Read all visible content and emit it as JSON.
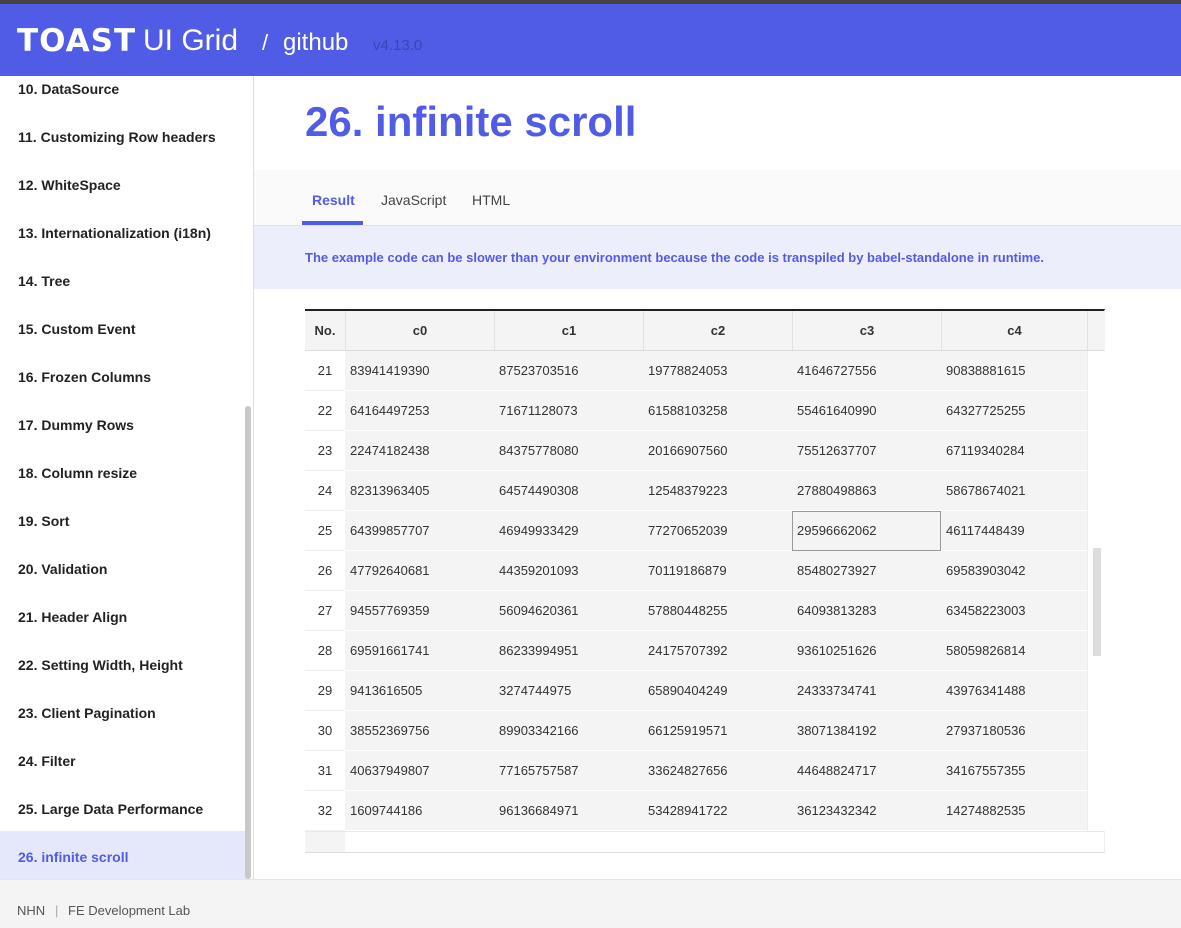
{
  "header": {
    "logo_toast": "TOAST",
    "logo_product": "UI Grid",
    "separator": "/",
    "github_link": "github",
    "version": "v4.13.0"
  },
  "sidebar": {
    "items": [
      {
        "label": "10. DataSource"
      },
      {
        "label": "11. Customizing Row headers"
      },
      {
        "label": "12. WhiteSpace"
      },
      {
        "label": "13. Internationalization (i18n)"
      },
      {
        "label": "14. Tree"
      },
      {
        "label": "15. Custom Event"
      },
      {
        "label": "16. Frozen Columns"
      },
      {
        "label": "17. Dummy Rows"
      },
      {
        "label": "18. Column resize"
      },
      {
        "label": "19. Sort"
      },
      {
        "label": "20. Validation"
      },
      {
        "label": "21. Header Align"
      },
      {
        "label": "22. Setting Width, Height"
      },
      {
        "label": "23. Client Pagination"
      },
      {
        "label": "24. Filter"
      },
      {
        "label": "25. Large Data Performance"
      },
      {
        "label": "26. infinite scroll"
      }
    ],
    "active_index": 16
  },
  "main": {
    "title": "26. infinite scroll",
    "tabs": [
      {
        "label": "Result"
      },
      {
        "label": "JavaScript"
      },
      {
        "label": "HTML"
      }
    ],
    "active_tab": "Result",
    "notice": "The example code can be slower than your environment because the code is transpiled by babel-standalone in runtime."
  },
  "grid": {
    "columns": [
      "No.",
      "c0",
      "c1",
      "c2",
      "c3",
      "c4"
    ],
    "rows": [
      {
        "no": "21",
        "cells": [
          "83941419390",
          "87523703516",
          "19778824053",
          "41646727556",
          "90838881615"
        ]
      },
      {
        "no": "22",
        "cells": [
          "64164497253",
          "71671128073",
          "61588103258",
          "55461640990",
          "64327725255"
        ]
      },
      {
        "no": "23",
        "cells": [
          "22474182438",
          "84375778080",
          "20166907560",
          "75512637707",
          "67119340284"
        ]
      },
      {
        "no": "24",
        "cells": [
          "82313963405",
          "64574490308",
          "12548379223",
          "27880498863",
          "58678674021"
        ]
      },
      {
        "no": "25",
        "cells": [
          "64399857707",
          "46949933429",
          "77270652039",
          "29596662062",
          "46117448439"
        ]
      },
      {
        "no": "26",
        "cells": [
          "47792640681",
          "44359201093",
          "70119186879",
          "85480273927",
          "69583903042"
        ]
      },
      {
        "no": "27",
        "cells": [
          "94557769359",
          "56094620361",
          "57880448255",
          "64093813283",
          "63458223003"
        ]
      },
      {
        "no": "28",
        "cells": [
          "69591661741",
          "86233994951",
          "24175707392",
          "93610251626",
          "58059826814"
        ]
      },
      {
        "no": "29",
        "cells": [
          "9413616505",
          "3274744975",
          "65890404249",
          "24333734741",
          "43976341488"
        ]
      },
      {
        "no": "30",
        "cells": [
          "38552369756",
          "89903342166",
          "66125919571",
          "38071384192",
          "27937180536"
        ]
      },
      {
        "no": "31",
        "cells": [
          "40637949807",
          "77165757587",
          "33624827656",
          "44648824717",
          "34167557355"
        ]
      },
      {
        "no": "32",
        "cells": [
          "1609744186",
          "96136684971",
          "53428941722",
          "36123432342",
          "14274882535"
        ]
      }
    ],
    "focused_cell": {
      "row_no": "25",
      "column": "c3"
    }
  },
  "footer": {
    "company": "NHN",
    "separator": "|",
    "lab": "FE Development Lab"
  },
  "colors": {
    "brand": "#515ce6",
    "active_bg": "#e5e7fb",
    "notice_bg": "#eceefb"
  }
}
